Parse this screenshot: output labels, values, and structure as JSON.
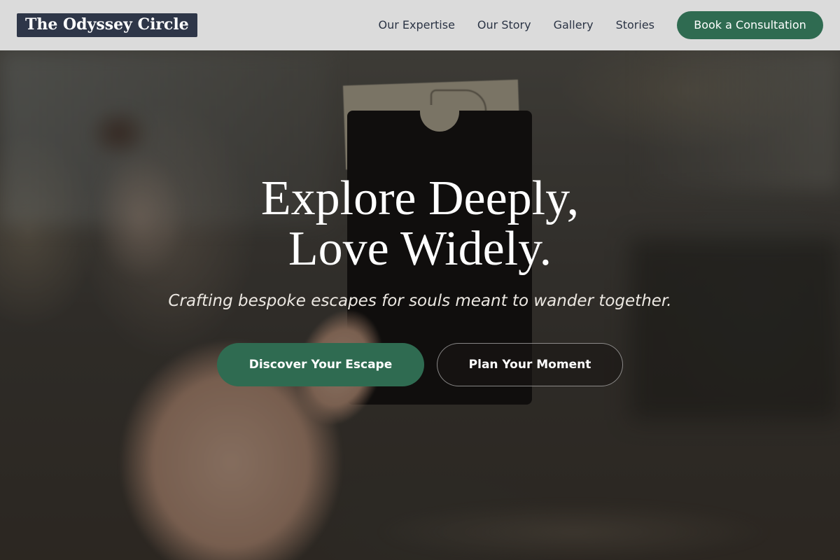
{
  "brand": {
    "name": "The Odyssey Circle"
  },
  "nav": {
    "links": [
      "Our Expertise",
      "Our Story",
      "Gallery",
      "Stories"
    ],
    "cta_label": "Book a Consultation"
  },
  "hero": {
    "title_line1": "Explore Deeply,",
    "title_line2": "Love Widely.",
    "subtitle": "Crafting bespoke escapes for souls meant to wander together.",
    "primary_button": "Discover Your Escape",
    "secondary_button": "Plan Your Moment"
  },
  "colors": {
    "accent": "#2f6b51",
    "brand_bg": "#2e3648",
    "nav_bg": "#e2e2e2",
    "nav_text": "#2b3445"
  }
}
